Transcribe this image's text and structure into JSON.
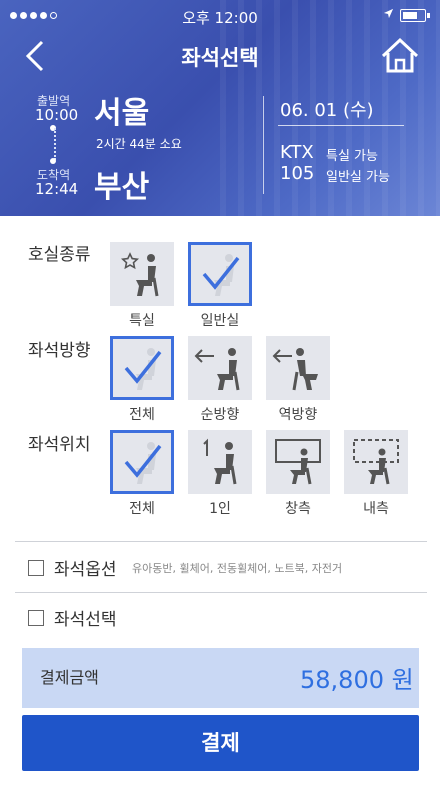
{
  "status_bar": {
    "time": "오후 12:00"
  },
  "header": {
    "title": "좌석선택",
    "departure_label": "출발역",
    "departure_time": "10:00",
    "arrival_label": "도착역",
    "arrival_time": "12:44",
    "from_city": "서울",
    "to_city": "부산",
    "duration": "2시간 44분 소요",
    "date": "06. 01 (수)",
    "train_type": "KTX",
    "train_number": "105",
    "seat_availability_1": "특실 가능",
    "seat_availability_2": "일반실 가능"
  },
  "room_type": {
    "label": "호실종류",
    "options": [
      {
        "label": "특실",
        "selected": false,
        "icon": "premium-seat-icon"
      },
      {
        "label": "일반실",
        "selected": true,
        "icon": "check-icon"
      }
    ]
  },
  "seat_direction": {
    "label": "좌석방향",
    "options": [
      {
        "label": "전체",
        "selected": true,
        "icon": "check-icon"
      },
      {
        "label": "순방향",
        "selected": false,
        "icon": "forward-seat-icon"
      },
      {
        "label": "역방향",
        "selected": false,
        "icon": "reverse-seat-icon"
      }
    ]
  },
  "seat_position": {
    "label": "좌석위치",
    "options": [
      {
        "label": "전체",
        "selected": true,
        "icon": "check-icon"
      },
      {
        "label": "1인",
        "selected": false,
        "icon": "single-seat-icon"
      },
      {
        "label": "창측",
        "selected": false,
        "icon": "window-seat-icon"
      },
      {
        "label": "내측",
        "selected": false,
        "icon": "aisle-seat-icon"
      }
    ]
  },
  "seat_options": {
    "label": "좌석옵션",
    "sub": "유아동반, 휠체어, 전동휠체어, 노트북, 자전거",
    "checked": false
  },
  "seat_select": {
    "label": "좌석선택",
    "checked": false
  },
  "payment": {
    "label": "결제금액",
    "amount": "58,800 원",
    "button": "결제"
  },
  "colors": {
    "accent": "#3d6fdd",
    "button": "#1f55c9",
    "header": "#3f56b4"
  }
}
